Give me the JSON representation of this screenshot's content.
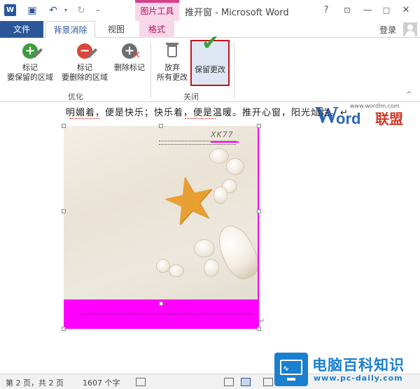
{
  "titlebar": {
    "app_icon_letter": "W",
    "contextual_group": "图片工具",
    "window_title": "推开窗 - Microsoft Word",
    "help": "?",
    "minimize": "—",
    "maximize": "□",
    "close": "✕"
  },
  "tabs": {
    "file": "文件",
    "background_removal": "背景消除",
    "view": "视图",
    "format": "格式",
    "login": "登录"
  },
  "ribbon": {
    "keep_mark_line1": "标记",
    "keep_mark_line2": "要保留的区域",
    "remove_mark_line1": "标记",
    "remove_mark_line2": "要删除的区域",
    "delete_mark": "删除标记",
    "discard_line1": "放弃",
    "discard_line2": "所有更改",
    "keep_changes": "保留更改",
    "group_refine": "优化",
    "group_close": "关闭"
  },
  "document": {
    "text_line": "明媚着，便是快乐；快乐着，便是温暖。推开心窗，阳光灿烂。↵",
    "image_brand": "XK77",
    "paragraph_mark": "↵"
  },
  "watermark": {
    "w": "W",
    "ord": "ord",
    "cn": "联盟",
    "url": "www.wordlm.com"
  },
  "statusbar": {
    "page": "第 2 页，共 2 页",
    "words": "1607 个字"
  },
  "badge": {
    "name": "电脑百科知识",
    "url": "www.pc-daily.com"
  },
  "colors": {
    "word_blue": "#2b579a",
    "picture_tools_pink": "#f8d7e8",
    "removal_magenta": "#ff00ff",
    "highlight_red_border": "#c0161c",
    "badge_blue": "#1b7fcf"
  },
  "icons": {
    "keep_mark": "plus-circle-pencil-icon",
    "remove_mark": "minus-circle-pencil-icon",
    "delete_mark": "circle-x-icon",
    "discard": "recycle-bin-icon",
    "keep_changes": "checkmark-icon"
  }
}
